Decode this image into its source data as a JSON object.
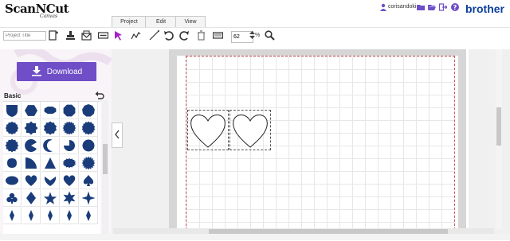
{
  "header": {
    "logo_main": "ScanNCut",
    "logo_sub": "Canvas",
    "tabs": [
      {
        "label": "Project"
      },
      {
        "label": "Edit"
      },
      {
        "label": "View"
      }
    ],
    "username": "corisandoki",
    "brand": "brother",
    "icons": [
      "user-icon",
      "folder-icon",
      "folder-open-icon",
      "signout-icon",
      "help-icon"
    ]
  },
  "toolbar": {
    "title_placeholder": "Project Title",
    "zoom_value": "62",
    "zoom_unit": "%",
    "icons": [
      "add-page-icon",
      "stamp-icon",
      "mail-icon",
      "transfer-icon",
      "select-arrow-icon",
      "pen-icon",
      "undo-icon",
      "redo-icon",
      "trash-icon",
      "keyboard-icon",
      "zoom-stepper-icon",
      "magnify-icon"
    ]
  },
  "sidebar": {
    "download_label": "Download",
    "category_label": "Basic",
    "shape_color": "#1a3c7a",
    "shapes": [
      "shield",
      "hexagon",
      "ellipse",
      "octagon",
      "nonagon",
      "wavy-circle",
      "flower-8",
      "wavy-hexagon",
      "starburst",
      "seal-16",
      "badge",
      "pacman",
      "crescent",
      "quarter-circle",
      "circle",
      "rounded-leaf",
      "quarter-pie",
      "triangle",
      "scallop-oval",
      "sun-seal",
      "heart-round",
      "heart-narrow",
      "heart-wide",
      "heart",
      "spade",
      "club",
      "diamond",
      "star-5",
      "star-6",
      "star-4"
    ]
  },
  "canvas": {
    "objects": [
      {
        "name": "heart-1",
        "type": "heart"
      },
      {
        "name": "heart-2",
        "type": "heart"
      }
    ]
  },
  "colors": {
    "accent": "#6f4ec7",
    "brand_blue": "#0b3f9c",
    "select_tool": "#a320c9",
    "cut_line": "#cc5555"
  }
}
